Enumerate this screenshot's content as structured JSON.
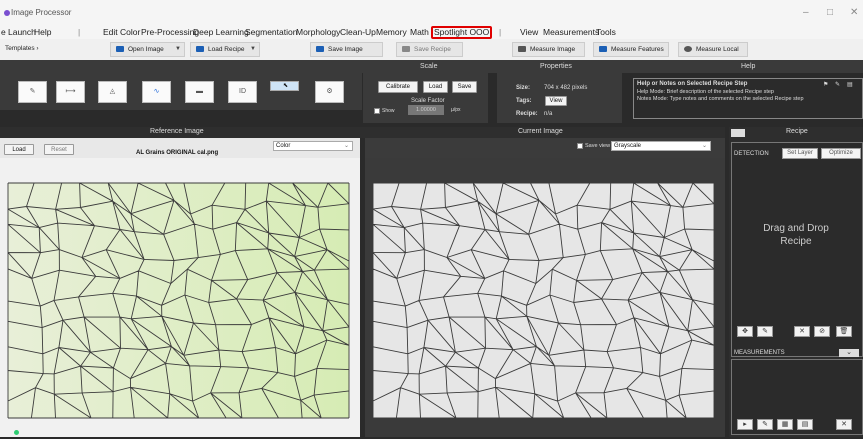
{
  "app": {
    "title": "Image Processor",
    "window_controls": [
      "–",
      "□",
      "✕"
    ]
  },
  "menu": {
    "left_items": [
      "e",
      "Launch",
      "Help"
    ],
    "items": [
      "Edit",
      "Color",
      "Pre-Processing",
      "Deep Learning",
      "Segmentation",
      "Morphology",
      "Clean-Up",
      "Memory",
      "Math"
    ],
    "highlight": "Spotlight OOO",
    "right_items": [
      "View",
      "Measurements",
      "Tools"
    ]
  },
  "toolbar": {
    "templates": "Templates ›",
    "open_image": "Open Image",
    "load_recipe": "Load Recipe",
    "save_image": "Save Image",
    "save_recipe": "Save Recipe",
    "measure_image": "Measure Image",
    "measure_features": "Measure Features",
    "measure_local": "Measure Local"
  },
  "panels": {
    "scale": "Scale",
    "properties": "Properties",
    "help": "Help"
  },
  "tools": [
    "✎",
    "⟼",
    "◬",
    "∿",
    "▬",
    "ID",
    "⬉",
    "⚙"
  ],
  "scale": {
    "calibrate": "Calibrate",
    "load": "Load",
    "save": "Save",
    "factor_label": "Scale Factor",
    "show_label": "Show",
    "factor_value": "1.00000",
    "unit": "µ/px"
  },
  "properties": {
    "size_label": "Size:",
    "size_value": "704 x 482 pixels",
    "tags_label": "Tags:",
    "tags_button": "View",
    "recipe_label": "Recipe:",
    "recipe_value": "n/a"
  },
  "help": {
    "title": "Help or Notes on Selected Recipe Step",
    "line1": "Help Mode:   Brief description of the selected Recipe step",
    "line2": "Notes Mode:  Type notes and comments on the selected Recipe step",
    "icons": [
      "⚑",
      "✎",
      "▤"
    ]
  },
  "reference": {
    "header": "Reference Image",
    "load": "Load",
    "reset": "Reset",
    "filename": "AL Grains ORIGINAL cal.png",
    "mode": "Color"
  },
  "current": {
    "header": "Current Image",
    "save_view": "Save view",
    "mode": "Grayscale"
  },
  "recipe": {
    "header": "Recipe",
    "detection": "DETECTION",
    "set_layer": "Set Layer",
    "optimize": "Optimize",
    "placeholder_1": "Drag and Drop",
    "placeholder_2": "Recipe",
    "detect_buttons": [
      "✥",
      "✎",
      "✕",
      "⊘",
      "🗑"
    ],
    "measurements": "MEASUREMENTS",
    "meas_buttons": [
      "▸",
      "✎",
      "▦",
      "▤",
      "✕"
    ]
  },
  "colors": {
    "accent": "#1b5fb5",
    "highlight": "#e00000",
    "ref_tint": "#dfeec0",
    "panel": "#3a3a3a"
  }
}
